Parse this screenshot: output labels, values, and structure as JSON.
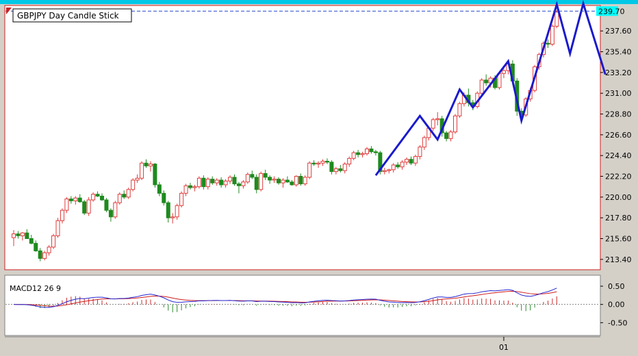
{
  "chart_data": [
    {
      "type": "candlestick",
      "title": "GBPJPY  Day  Candle Stick",
      "y_ticks": [
        "237.60",
        "235.40",
        "233.20",
        "231.00",
        "228.80",
        "226.60",
        "224.40",
        "222.20",
        "220.00",
        "217.80",
        "215.60",
        "213.40"
      ],
      "y_tick_values": [
        237.6,
        235.4,
        233.2,
        231.0,
        228.8,
        226.6,
        224.4,
        222.2,
        220.0,
        217.8,
        215.6,
        213.4
      ],
      "ylim": [
        212.3,
        240.3
      ],
      "last_price": "239.70",
      "last_price_value": 239.7,
      "candles": [
        [
          215.7,
          216.5,
          214.8,
          216.1
        ],
        [
          216.1,
          216.4,
          215.6,
          215.9
        ],
        [
          215.9,
          216.3,
          215.4,
          216.2
        ],
        [
          216.2,
          216.6,
          215.7,
          215.6
        ],
        [
          215.6,
          216.0,
          215.0,
          215.1
        ],
        [
          215.1,
          215.4,
          214.2,
          214.3
        ],
        [
          214.3,
          214.6,
          213.2,
          213.5
        ],
        [
          213.5,
          214.3,
          213.3,
          214.1
        ],
        [
          214.1,
          214.9,
          213.8,
          214.7
        ],
        [
          214.7,
          216.1,
          214.5,
          215.9
        ],
        [
          215.9,
          217.8,
          215.7,
          217.5
        ],
        [
          217.5,
          218.8,
          217.2,
          218.6
        ],
        [
          218.6,
          220.0,
          218.3,
          219.8
        ],
        [
          219.8,
          220.1,
          219.3,
          219.6
        ],
        [
          219.6,
          220.1,
          219.2,
          219.9
        ],
        [
          219.9,
          220.3,
          219.4,
          219.5
        ],
        [
          219.5,
          219.7,
          218.1,
          218.3
        ],
        [
          218.3,
          220.0,
          218.0,
          219.7
        ],
        [
          219.7,
          220.5,
          219.5,
          220.3
        ],
        [
          220.3,
          220.6,
          220.0,
          220.1
        ],
        [
          220.1,
          220.4,
          219.6,
          219.7
        ],
        [
          219.7,
          219.9,
          218.4,
          218.6
        ],
        [
          218.6,
          218.8,
          217.4,
          217.9
        ],
        [
          217.9,
          219.6,
          217.7,
          219.4
        ],
        [
          219.4,
          220.5,
          219.2,
          220.3
        ],
        [
          220.3,
          220.7,
          219.8,
          220.0
        ],
        [
          220.0,
          221.0,
          219.8,
          220.8
        ],
        [
          220.8,
          222.0,
          220.6,
          221.8
        ],
        [
          221.8,
          222.4,
          221.5,
          222.0
        ],
        [
          222.0,
          223.8,
          221.8,
          223.6
        ],
        [
          223.6,
          224.0,
          223.1,
          223.3
        ],
        [
          223.3,
          223.8,
          222.7,
          223.5
        ],
        [
          223.5,
          223.6,
          221.0,
          221.3
        ],
        [
          221.3,
          221.6,
          220.1,
          220.4
        ],
        [
          220.4,
          220.7,
          219.1,
          219.4
        ],
        [
          219.4,
          219.6,
          217.3,
          217.8
        ],
        [
          217.8,
          218.3,
          217.2,
          217.9
        ],
        [
          217.9,
          219.3,
          217.6,
          219.1
        ],
        [
          219.1,
          220.6,
          218.9,
          220.4
        ],
        [
          220.4,
          221.4,
          220.1,
          221.2
        ],
        [
          221.2,
          221.5,
          220.8,
          221.0
        ],
        [
          221.0,
          221.3,
          220.6,
          221.1
        ],
        [
          221.1,
          222.2,
          220.9,
          222.0
        ],
        [
          222.0,
          222.3,
          220.8,
          221.1
        ],
        [
          221.1,
          222.1,
          220.8,
          221.9
        ],
        [
          221.9,
          222.2,
          221.3,
          221.5
        ],
        [
          221.5,
          222.0,
          221.2,
          221.8
        ],
        [
          221.8,
          222.1,
          221.0,
          221.3
        ],
        [
          221.3,
          221.9,
          221.0,
          221.7
        ],
        [
          221.7,
          222.3,
          221.4,
          222.1
        ],
        [
          222.1,
          222.4,
          221.2,
          221.4
        ],
        [
          221.4,
          221.6,
          220.4,
          221.2
        ],
        [
          221.2,
          221.8,
          220.9,
          221.6
        ],
        [
          221.6,
          222.6,
          221.4,
          222.4
        ],
        [
          222.4,
          222.8,
          221.9,
          222.1
        ],
        [
          222.1,
          222.4,
          220.4,
          220.8
        ],
        [
          220.8,
          222.7,
          220.6,
          222.5
        ],
        [
          222.5,
          222.9,
          221.8,
          222.1
        ],
        [
          222.1,
          222.3,
          221.4,
          221.8
        ],
        [
          221.8,
          222.2,
          221.5,
          221.9
        ],
        [
          221.9,
          222.1,
          221.3,
          221.5
        ],
        [
          221.5,
          222.0,
          221.0,
          221.8
        ],
        [
          221.8,
          222.2,
          221.5,
          221.6
        ],
        [
          221.6,
          221.8,
          221.2,
          221.3
        ],
        [
          221.3,
          222.3,
          221.1,
          222.2
        ],
        [
          222.2,
          222.5,
          221.2,
          221.4
        ],
        [
          221.4,
          222.3,
          221.2,
          222.1
        ],
        [
          222.1,
          223.8,
          221.9,
          223.6
        ],
        [
          223.6,
          223.9,
          223.3,
          223.5
        ],
        [
          223.5,
          223.8,
          223.1,
          223.6
        ],
        [
          223.6,
          224.0,
          223.3,
          223.8
        ],
        [
          223.8,
          224.1,
          223.5,
          223.7
        ],
        [
          223.7,
          223.9,
          222.4,
          222.7
        ],
        [
          222.7,
          223.2,
          222.4,
          223.0
        ],
        [
          223.0,
          223.4,
          222.6,
          222.8
        ],
        [
          222.8,
          223.7,
          222.5,
          223.5
        ],
        [
          223.5,
          224.3,
          223.2,
          224.1
        ],
        [
          224.1,
          224.9,
          223.9,
          224.7
        ],
        [
          224.7,
          225.0,
          224.2,
          224.5
        ],
        [
          224.5,
          224.8,
          224.2,
          224.6
        ],
        [
          224.6,
          225.3,
          224.4,
          225.1
        ],
        [
          225.1,
          225.4,
          224.6,
          224.8
        ],
        [
          224.8,
          225.0,
          224.4,
          224.7
        ],
        [
          224.7,
          224.9,
          222.4,
          222.7
        ],
        [
          222.7,
          223.1,
          222.4,
          222.8
        ],
        [
          222.8,
          223.0,
          222.5,
          222.9
        ],
        [
          222.9,
          223.6,
          222.6,
          223.4
        ],
        [
          223.4,
          223.7,
          223.0,
          223.2
        ],
        [
          223.2,
          223.9,
          222.9,
          223.7
        ],
        [
          223.7,
          224.2,
          223.4,
          224.0
        ],
        [
          224.0,
          224.3,
          223.4,
          223.6
        ],
        [
          223.6,
          224.5,
          223.3,
          224.3
        ],
        [
          224.3,
          225.5,
          224.0,
          225.3
        ],
        [
          225.3,
          226.5,
          225.0,
          226.3
        ],
        [
          226.3,
          227.5,
          226.0,
          227.3
        ],
        [
          227.3,
          228.4,
          227.0,
          228.2
        ],
        [
          228.2,
          229.0,
          227.6,
          228.3
        ],
        [
          228.3,
          228.6,
          226.4,
          226.8
        ],
        [
          226.8,
          227.0,
          225.9,
          226.2
        ],
        [
          226.2,
          227.1,
          225.9,
          226.9
        ],
        [
          226.9,
          228.8,
          226.7,
          228.6
        ],
        [
          228.6,
          230.1,
          228.4,
          229.9
        ],
        [
          229.9,
          231.1,
          229.6,
          230.8
        ],
        [
          230.8,
          231.5,
          229.6,
          230.0
        ],
        [
          230.0,
          230.3,
          229.2,
          229.6
        ],
        [
          229.6,
          231.2,
          229.4,
          231.0
        ],
        [
          231.0,
          232.6,
          230.8,
          232.4
        ],
        [
          232.4,
          233.0,
          231.8,
          232.1
        ],
        [
          232.1,
          232.8,
          231.6,
          232.6
        ],
        [
          232.6,
          232.9,
          231.4,
          231.6
        ],
        [
          231.6,
          233.3,
          231.4,
          233.1
        ],
        [
          233.1,
          233.6,
          232.6,
          233.4
        ],
        [
          233.4,
          234.5,
          233.0,
          234.1
        ],
        [
          234.1,
          234.5,
          231.9,
          232.3
        ],
        [
          232.3,
          232.6,
          228.6,
          229.1
        ],
        [
          229.1,
          229.4,
          228.4,
          228.7
        ],
        [
          228.7,
          230.6,
          228.5,
          230.4
        ],
        [
          230.4,
          231.6,
          230.1,
          231.3
        ],
        [
          231.3,
          234.0,
          231.1,
          233.8
        ],
        [
          233.8,
          235.3,
          233.5,
          235.1
        ],
        [
          235.1,
          236.5,
          234.8,
          236.3
        ],
        [
          236.3,
          236.7,
          235.8,
          236.2
        ],
        [
          236.2,
          238.3,
          236.0,
          238.1
        ],
        [
          238.1,
          239.8,
          237.9,
          239.6
        ]
      ],
      "zigzag": [
        {
          "i": 82,
          "price": 222.3
        },
        {
          "i": 92,
          "price": 228.6
        },
        {
          "i": 96,
          "price": 226.1
        },
        {
          "i": 101,
          "price": 231.4
        },
        {
          "i": 104,
          "price": 229.5
        },
        {
          "i": 112,
          "price": 234.4
        },
        {
          "i": 115,
          "price": 228.1
        },
        {
          "i": 123,
          "price": 240.4
        },
        {
          "i": 126,
          "price": 235.2
        },
        {
          "i": 129,
          "price": 240.5
        },
        {
          "i": 134,
          "price": 233.0
        }
      ],
      "x_label": "01",
      "x_label_index": 111
    },
    {
      "type": "macd",
      "title": "MACD12 26 9",
      "y_ticks": [
        "0.50",
        "0.00",
        "-0.50"
      ],
      "y_tick_values": [
        0.5,
        0.0,
        -0.5
      ],
      "ylim": [
        -0.85,
        0.8
      ]
    }
  ],
  "colors": {
    "up_candle": "#e03a3a",
    "down_candle": "#1e8a1e",
    "zigzag": "#1a1acc",
    "macd_line": "#2222d0",
    "signal_line": "#d01a1a",
    "histogram_positive": "#cc2a2a",
    "histogram_negative": "#2a8a2a",
    "price_line": "#2244cc",
    "price_label_bg": "#00ffff",
    "frame_border": "#cc2020"
  }
}
